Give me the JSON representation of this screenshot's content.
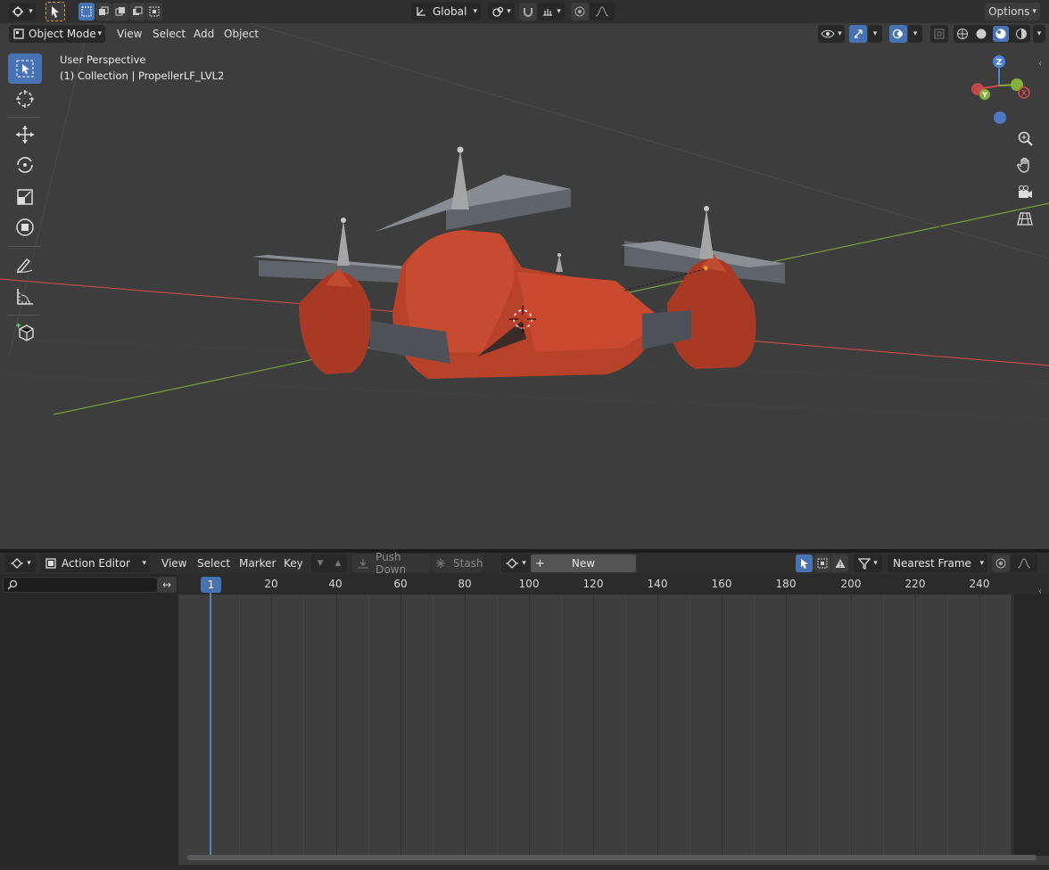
{
  "viewport_header": {
    "transform_orientation": "Global",
    "options_label": "Options"
  },
  "viewport_menu": {
    "mode": "Object Mode",
    "items": [
      "View",
      "Select",
      "Add",
      "Object"
    ]
  },
  "viewport": {
    "perspective_label": "User Perspective",
    "collection_label": "(1) Collection | PropellerLF_LVL2",
    "gizmo_axes": [
      "X",
      "Y",
      "Z"
    ]
  },
  "toolbar": {
    "tools": [
      "select-box",
      "cursor",
      "move",
      "rotate",
      "scale",
      "transform",
      "annotate",
      "measure",
      "add-cube"
    ],
    "active": "select-box"
  },
  "action_editor": {
    "editor_type": "Action Editor",
    "menus": [
      "View",
      "Select",
      "Marker",
      "Key"
    ],
    "push_down": "Push Down",
    "stash": "Stash",
    "new_label": "New",
    "snapping": "Nearest Frame",
    "current_frame": "1",
    "frame_ticks": [
      "20",
      "40",
      "60",
      "80",
      "100",
      "120",
      "140",
      "160",
      "180",
      "200",
      "220",
      "240"
    ]
  },
  "colors": {
    "accent": "#4772b3",
    "model_red": "#b8412a",
    "propeller_grey": "#6e7178",
    "axis_x": "#c24a4a",
    "axis_y": "#7aa03a"
  }
}
